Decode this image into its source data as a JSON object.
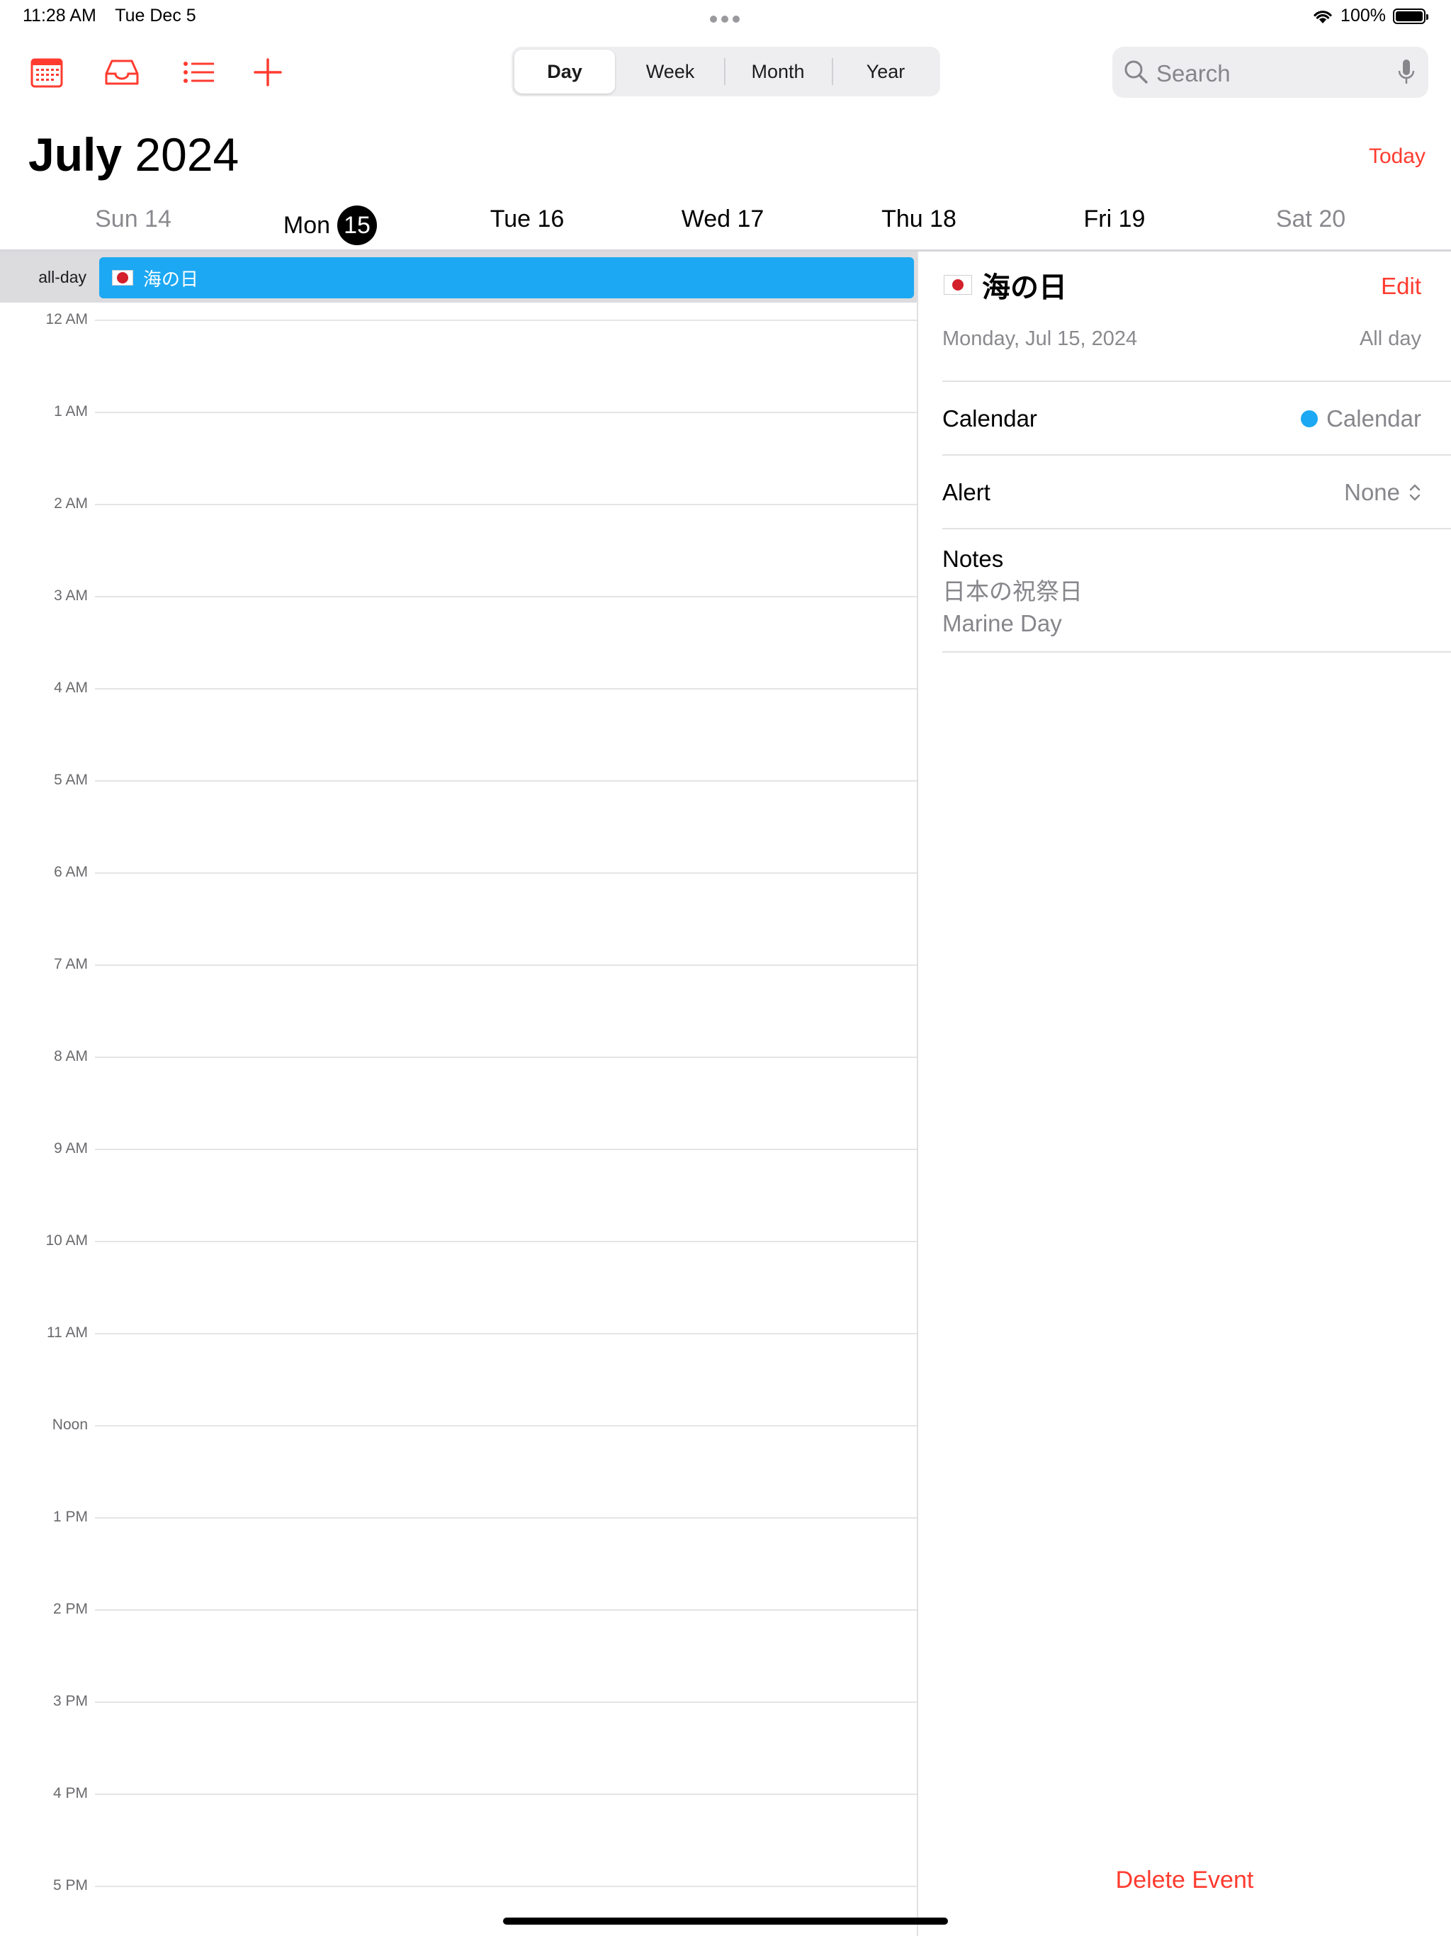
{
  "status_bar": {
    "time": "11:28 AM",
    "date": "Tue Dec 5",
    "battery": "100%"
  },
  "toolbar": {
    "icons": [
      "calendar-icon",
      "inbox-icon",
      "list-icon",
      "add-icon"
    ],
    "view_tabs": [
      {
        "label": "Day",
        "selected": true
      },
      {
        "label": "Week",
        "selected": false
      },
      {
        "label": "Month",
        "selected": false
      },
      {
        "label": "Year",
        "selected": false
      }
    ],
    "search_placeholder": "Search"
  },
  "header": {
    "month": "July",
    "year": "2024",
    "today_label": "Today"
  },
  "days": [
    {
      "label": "Sun 14"
    },
    {
      "label": "Mon",
      "day_num": "15",
      "today": true
    },
    {
      "label": "Tue 16"
    },
    {
      "label": "Wed 17"
    },
    {
      "label": "Thu 18"
    },
    {
      "label": "Fri 19"
    },
    {
      "label": "Sat 20"
    }
  ],
  "all_day": {
    "label": "all-day",
    "event_title": "海の日",
    "event_color": "#1ca8f2"
  },
  "hours": [
    "12 AM",
    "1 AM",
    "2 AM",
    "3 AM",
    "4 AM",
    "5 AM",
    "6 AM",
    "7 AM",
    "8 AM",
    "9 AM",
    "10 AM",
    "11 AM",
    "Noon",
    "1 PM",
    "2 PM",
    "3 PM",
    "4 PM",
    "5 PM"
  ],
  "detail": {
    "title": "海の日",
    "edit_label": "Edit",
    "date": "Monday, Jul 15, 2024",
    "all_day_label": "All day",
    "calendar_label": "Calendar",
    "calendar_value": "Calendar",
    "alert_label": "Alert",
    "alert_value": "None",
    "notes_label": "Notes",
    "notes_lines": [
      "日本の祝祭日",
      "Marine Day"
    ],
    "delete_label": "Delete Event"
  },
  "colors": {
    "accent": "#ff3b30",
    "event_blue": "#1ca8f2"
  }
}
